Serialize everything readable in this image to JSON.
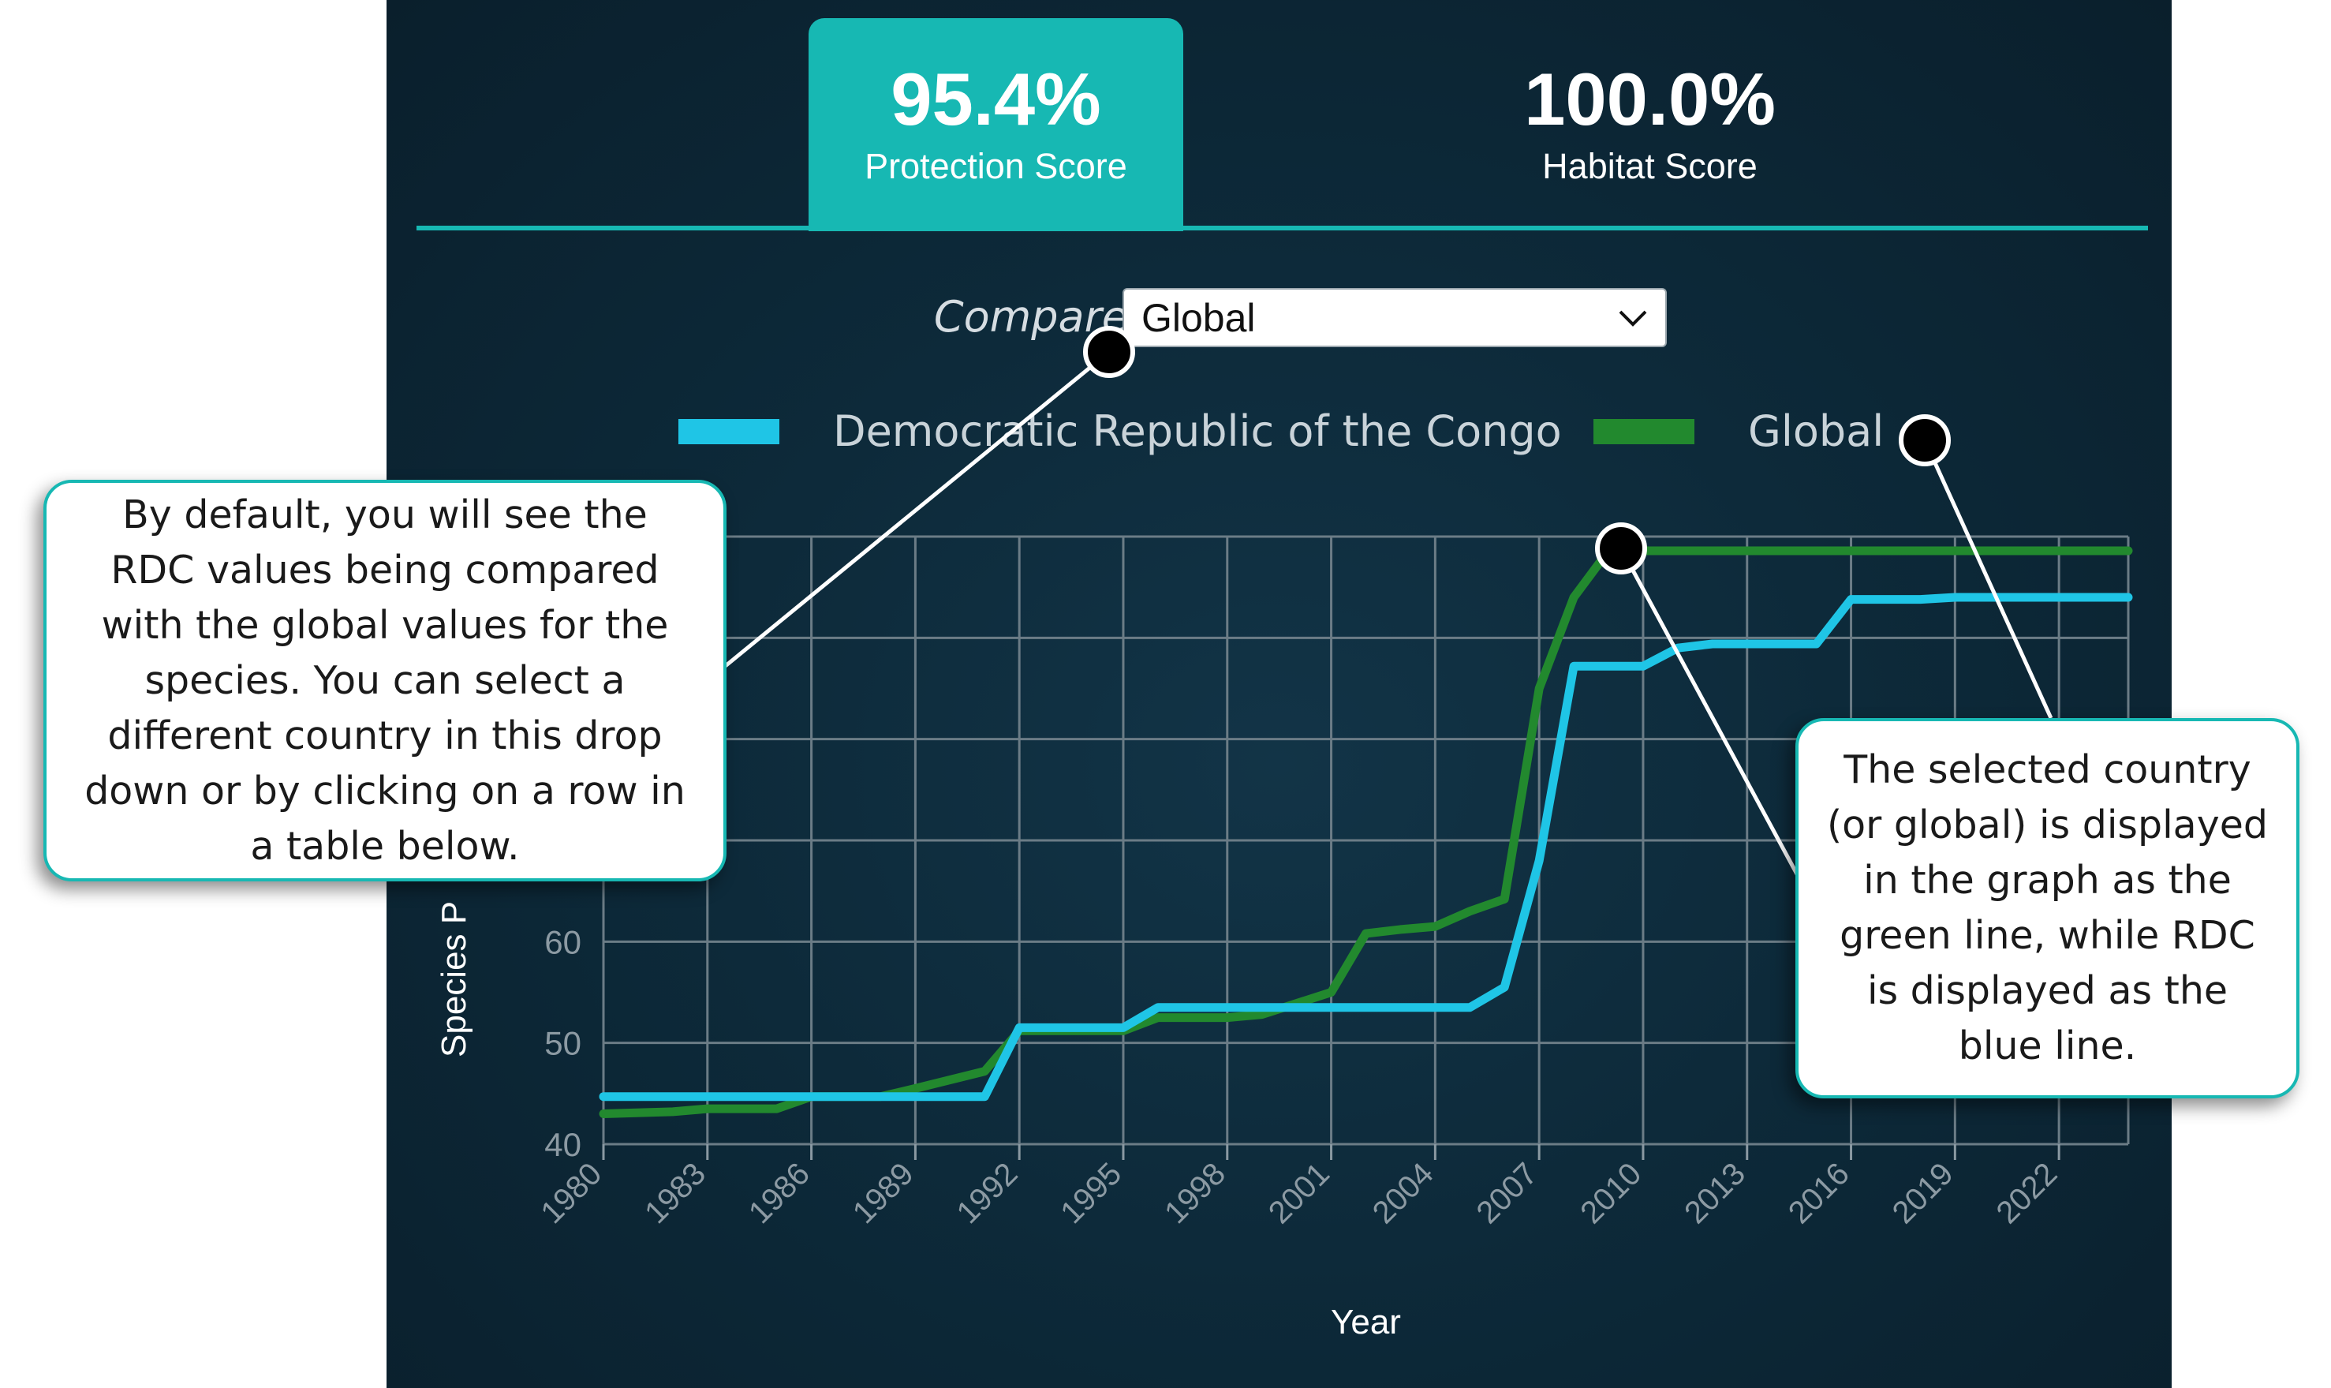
{
  "scores": {
    "protection": {
      "value": "95.4%",
      "label": "Protection Score"
    },
    "habitat": {
      "value": "100.0%",
      "label": "Habitat Score"
    }
  },
  "compare": {
    "label": "Compare",
    "selected": "Global"
  },
  "colors": {
    "accent": "#17b8b3",
    "rdc_line": "#1fc5e6",
    "global_line": "#22892e"
  },
  "chart_data": {
    "type": "line",
    "xlabel": "Year",
    "ylabel": "Species P",
    "x_ticks": [
      "1980",
      "1983",
      "1986",
      "1989",
      "1992",
      "1995",
      "1998",
      "2001",
      "2004",
      "2007",
      "2010",
      "2013",
      "2016",
      "2019",
      "2022"
    ],
    "y_ticks": [
      "40",
      "50",
      "60"
    ],
    "ylim": [
      40,
      100
    ],
    "xlim": [
      1980,
      2024
    ],
    "grid": true,
    "legend_position": "top",
    "series": [
      {
        "name": "Democratic Republic of the Congo",
        "x": [
          1980,
          1991,
          1991,
          1992,
          1995,
          1996,
          2005,
          2006,
          2007,
          2008,
          2010,
          2011,
          2012,
          2015,
          2016,
          2018,
          2019,
          2024
        ],
        "values": [
          44.7,
          44.7,
          44.7,
          51.5,
          51.5,
          53.5,
          53.5,
          55.5,
          68,
          87.2,
          87.2,
          89,
          89.4,
          89.4,
          93.8,
          93.8,
          94,
          94
        ]
      },
      {
        "name": "Global",
        "x": [
          1980,
          1982,
          1983,
          1985,
          1986,
          1988,
          1989,
          1991,
          1992,
          1995,
          1996,
          1998,
          1999,
          2001,
          2002,
          2003,
          2004,
          2005,
          2006,
          2007,
          2008,
          2009,
          2024
        ],
        "values": [
          43,
          43.2,
          43.5,
          43.5,
          44.7,
          44.7,
          45.5,
          47.2,
          51.2,
          51.2,
          52.5,
          52.5,
          52.8,
          55,
          60.8,
          61.2,
          61.5,
          63,
          64.2,
          85,
          94,
          98.6,
          98.6
        ]
      }
    ]
  },
  "callouts": {
    "left": "By default, you will see the RDC values being compared with the global values for the species. You can select a different country in this drop down or by clicking on a row in a table below.",
    "right": "The selected country (or global) is displayed in the graph as the green line, while RDC is displayed as the blue line."
  }
}
